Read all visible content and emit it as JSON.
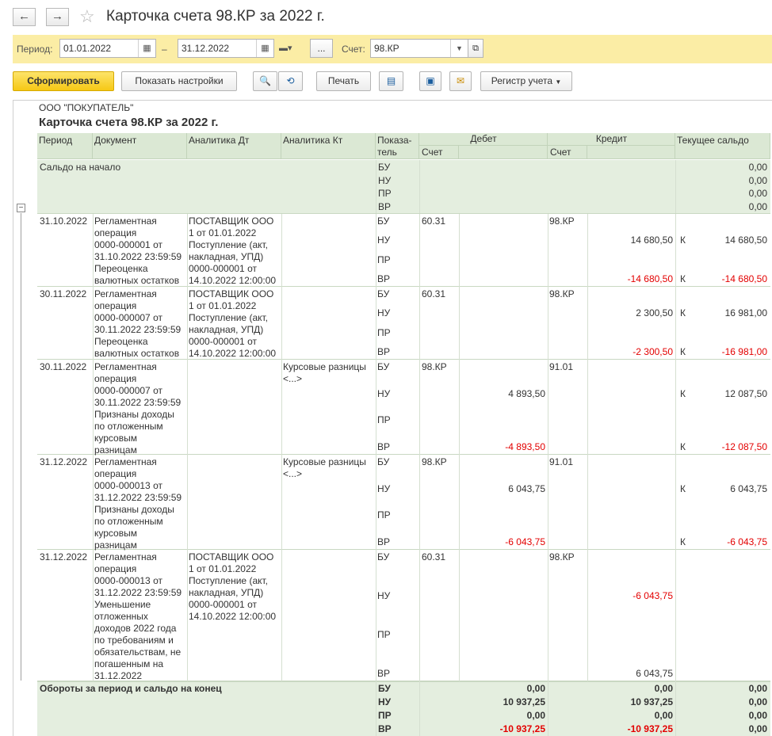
{
  "window": {
    "title": "Карточка счета 98.КР за 2022 г.",
    "back_icon": "←",
    "forward_icon": "→",
    "star_icon": "☆"
  },
  "params": {
    "period_label": "Период:",
    "date_from": "01.01.2022",
    "date_sep": "–",
    "date_to": "31.12.2022",
    "more_btn": "...",
    "account_label": "Счет:",
    "account": "98.КР"
  },
  "toolbar": {
    "generate": "Сформировать",
    "settings": "Показать настройки",
    "print": "Печать",
    "register": "Регистр учета"
  },
  "report": {
    "org": "ООО \"ПОКУПАТЕЛЬ\"",
    "title": "Карточка счета 98.КР за 2022 г.",
    "headers": {
      "period": "Период",
      "document": "Документ",
      "an_dt": "Аналитика Дт",
      "an_kt": "Аналитика Кт",
      "indicator_1": "Показа-",
      "indicator_2": "тель",
      "debit": "Дебет",
      "credit": "Кредит",
      "account": "Счет",
      "balance": "Текущее сальдо"
    },
    "indicators": [
      "БУ",
      "НУ",
      "ПР",
      "ВР"
    ],
    "opening": {
      "label": "Сальдо на начало",
      "values": [
        "0,00",
        "0,00",
        "0,00",
        "0,00"
      ]
    },
    "rows": [
      {
        "period": "31.10.2022",
        "doc": [
          "Регламентная",
          "операция",
          "0000-000001 от",
          "31.10.2022 23:59:59",
          "Переоценка",
          "валютных остатков"
        ],
        "an_dt": [
          "ПОСТАВЩИК ООО",
          "1 от 01.01.2022",
          "Поступление (акт,",
          "накладная, УПД)",
          "0000-000001 от",
          "14.10.2022 12:00:00"
        ],
        "an_kt": [],
        "dt_acc": "60.31",
        "kt_acc": "98.КР",
        "nu_dt": "",
        "vr_dt": "",
        "nu_kt": "14 680,50",
        "vr_kt": "-14 680,50",
        "nu_k": "К",
        "nu_bal": "14 680,50",
        "vr_k": "К",
        "vr_bal": "-14 680,50"
      },
      {
        "period": "30.11.2022",
        "doc": [
          "Регламентная",
          "операция",
          "0000-000007 от",
          "30.11.2022 23:59:59",
          "Переоценка",
          "валютных остатков"
        ],
        "an_dt": [
          "ПОСТАВЩИК ООО",
          "1 от 01.01.2022",
          "Поступление (акт,",
          "накладная, УПД)",
          "0000-000001 от",
          "14.10.2022 12:00:00"
        ],
        "an_kt": [],
        "dt_acc": "60.31",
        "kt_acc": "98.КР",
        "nu_dt": "",
        "vr_dt": "",
        "nu_kt": "2 300,50",
        "vr_kt": "-2 300,50",
        "nu_k": "К",
        "nu_bal": "16 981,00",
        "vr_k": "К",
        "vr_bal": "-16 981,00"
      },
      {
        "period": "30.11.2022",
        "doc": [
          "Регламентная",
          "операция",
          "0000-000007 от",
          "30.11.2022 23:59:59",
          "Признаны доходы",
          "по отложенным",
          "курсовым",
          "разницам"
        ],
        "an_dt": [],
        "an_kt": [
          "Курсовые разницы",
          "<...>"
        ],
        "dt_acc": "98.КР",
        "kt_acc": "91.01",
        "nu_dt": "4 893,50",
        "vr_dt": "-4 893,50",
        "nu_kt": "",
        "vr_kt": "",
        "nu_k": "К",
        "nu_bal": "12 087,50",
        "vr_k": "К",
        "vr_bal": "-12 087,50"
      },
      {
        "period": "31.12.2022",
        "doc": [
          "Регламентная",
          "операция",
          "0000-000013 от",
          "31.12.2022 23:59:59",
          "Признаны доходы",
          "по отложенным",
          "курсовым",
          "разницам"
        ],
        "an_dt": [],
        "an_kt": [
          "Курсовые разницы",
          "<...>"
        ],
        "dt_acc": "98.КР",
        "kt_acc": "91.01",
        "nu_dt": "6 043,75",
        "vr_dt": "-6 043,75",
        "nu_kt": "",
        "vr_kt": "",
        "nu_k": "К",
        "nu_bal": "6 043,75",
        "vr_k": "К",
        "vr_bal": "-6 043,75"
      },
      {
        "period": "31.12.2022",
        "doc": [
          "Регламентная",
          "операция",
          "0000-000013 от",
          "31.12.2022 23:59:59",
          "Уменьшение",
          "отложенных",
          "доходов 2022 года",
          "по требованиям и",
          "обязательствам, не",
          "погашенным на",
          "31.12.2022"
        ],
        "an_dt": [
          "ПОСТАВЩИК ООО",
          "1 от 01.01.2022",
          "Поступление (акт,",
          "накладная, УПД)",
          "0000-000001 от",
          "14.10.2022 12:00:00"
        ],
        "an_kt": [],
        "dt_acc": "60.31",
        "kt_acc": "98.КР",
        "nu_dt": "",
        "vr_dt": "",
        "nu_kt": "-6 043,75",
        "vr_kt": "6 043,75",
        "nu_k": "",
        "nu_bal": "",
        "vr_k": "",
        "vr_bal": ""
      }
    ],
    "totals": {
      "label": "Обороты за период и сальдо на конец",
      "debit": [
        "0,00",
        "10 937,25",
        "0,00",
        "-10 937,25"
      ],
      "credit": [
        "0,00",
        "10 937,25",
        "0,00",
        "-10 937,25"
      ],
      "balance": [
        "0,00",
        "0,00",
        "0,00",
        "0,00"
      ]
    }
  }
}
